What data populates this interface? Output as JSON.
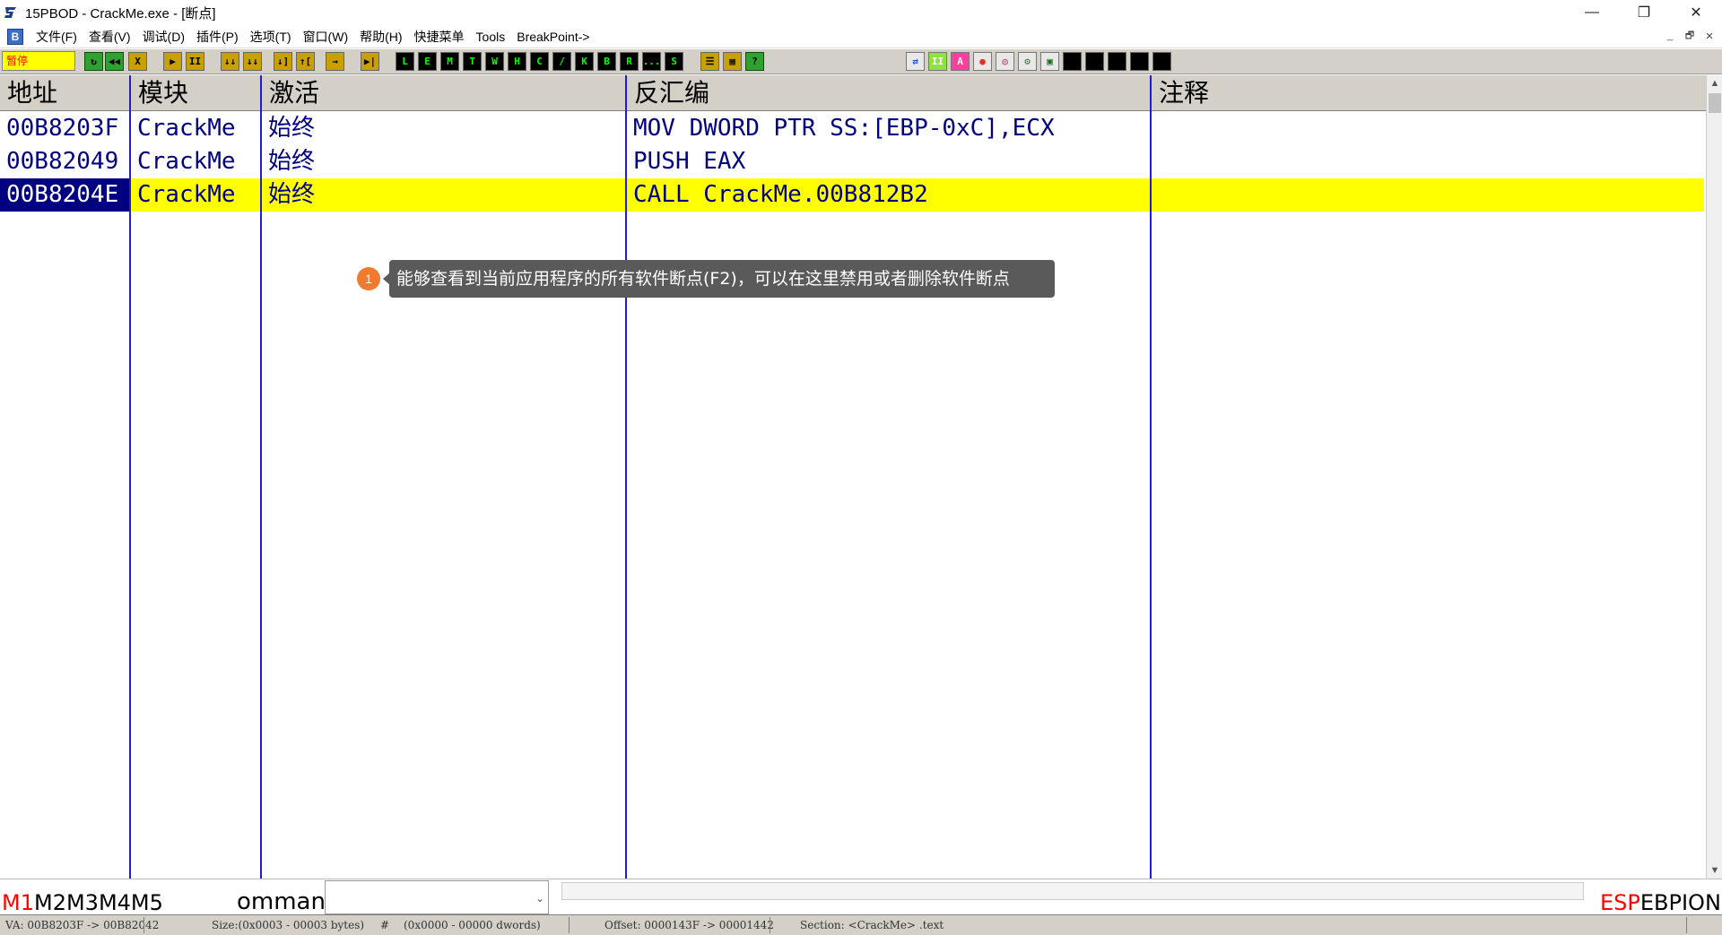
{
  "window": {
    "title": "15PBOD  - CrackMe.exe - [断点]",
    "controls": {
      "minimize": "—",
      "maximize": "❐",
      "close": "✕"
    }
  },
  "menu": {
    "logo": "B",
    "items": [
      "文件(F)",
      "查看(V)",
      "调试(D)",
      "插件(P)",
      "选项(T)",
      "窗口(W)",
      "帮助(H)",
      "快捷菜单",
      "Tools",
      "BreakPoint->"
    ],
    "mdi": {
      "minimize": "_",
      "restore": "🗗",
      "close": "✕"
    }
  },
  "toolbar": {
    "status_badge": "暂停",
    "left_buttons": [
      "↻",
      "◀◀",
      "X",
      "▶",
      "II",
      "↓↓",
      "↓↓",
      "↓]",
      "↑[",
      "→",
      "▶|"
    ],
    "letter_buttons": [
      "L",
      "E",
      "M",
      "T",
      "W",
      "H",
      "C",
      "/",
      "K",
      "B",
      "R",
      "...",
      "S"
    ],
    "grid_buttons": [
      "☰",
      "▦",
      "?"
    ],
    "right_buttons": [
      "⇄",
      "II",
      "A",
      "●",
      "◎",
      "⚙",
      "▣",
      "",
      "",
      "",
      "",
      ""
    ]
  },
  "table": {
    "columns": [
      "地址",
      "模块",
      "激活",
      "反汇编",
      "注释"
    ],
    "rows": [
      {
        "address": "00B8203F",
        "module": "CrackMe",
        "active": "始终",
        "disasm": "MOV DWORD PTR SS:[EBP-0xC],ECX",
        "comment": ""
      },
      {
        "address": "00B82049",
        "module": "CrackMe",
        "active": "始终",
        "disasm": "PUSH EAX",
        "comment": ""
      },
      {
        "address": "00B8204E",
        "module": "CrackMe",
        "active": "始终",
        "disasm": "CALL CrackMe.00B812B2",
        "comment": ""
      }
    ],
    "selected_row": 2,
    "selection_color": "#ffff00"
  },
  "annotation": {
    "number": "1",
    "text": "能够查看到当前应用程序的所有软件断点(F2)，可以在这里禁用或者删除软件断点"
  },
  "command": {
    "tabs": {
      "active": "M1",
      "others": "M2M3M4M5"
    },
    "label": "ommand",
    "input_value": "",
    "dropdown_icon": "⌄",
    "registers": {
      "red": "ESP",
      "rest": "EBPIONI"
    }
  },
  "statusbar": {
    "va": "VA: 00B8203F -> 00B82042",
    "size": "Size:(0x0003 - 00003 bytes)",
    "hash": "#",
    "dwords": "(0x0000 - 00000 dwords)",
    "offset": "Offset: 0000143F -> 00001442",
    "section": "Section: <CrackMe> .text"
  },
  "colors": {
    "table_text": "#000080",
    "column_separator": "#1f1fcf",
    "badge": "#f07a2d",
    "tooltip_bg": "#5a5a5a"
  }
}
